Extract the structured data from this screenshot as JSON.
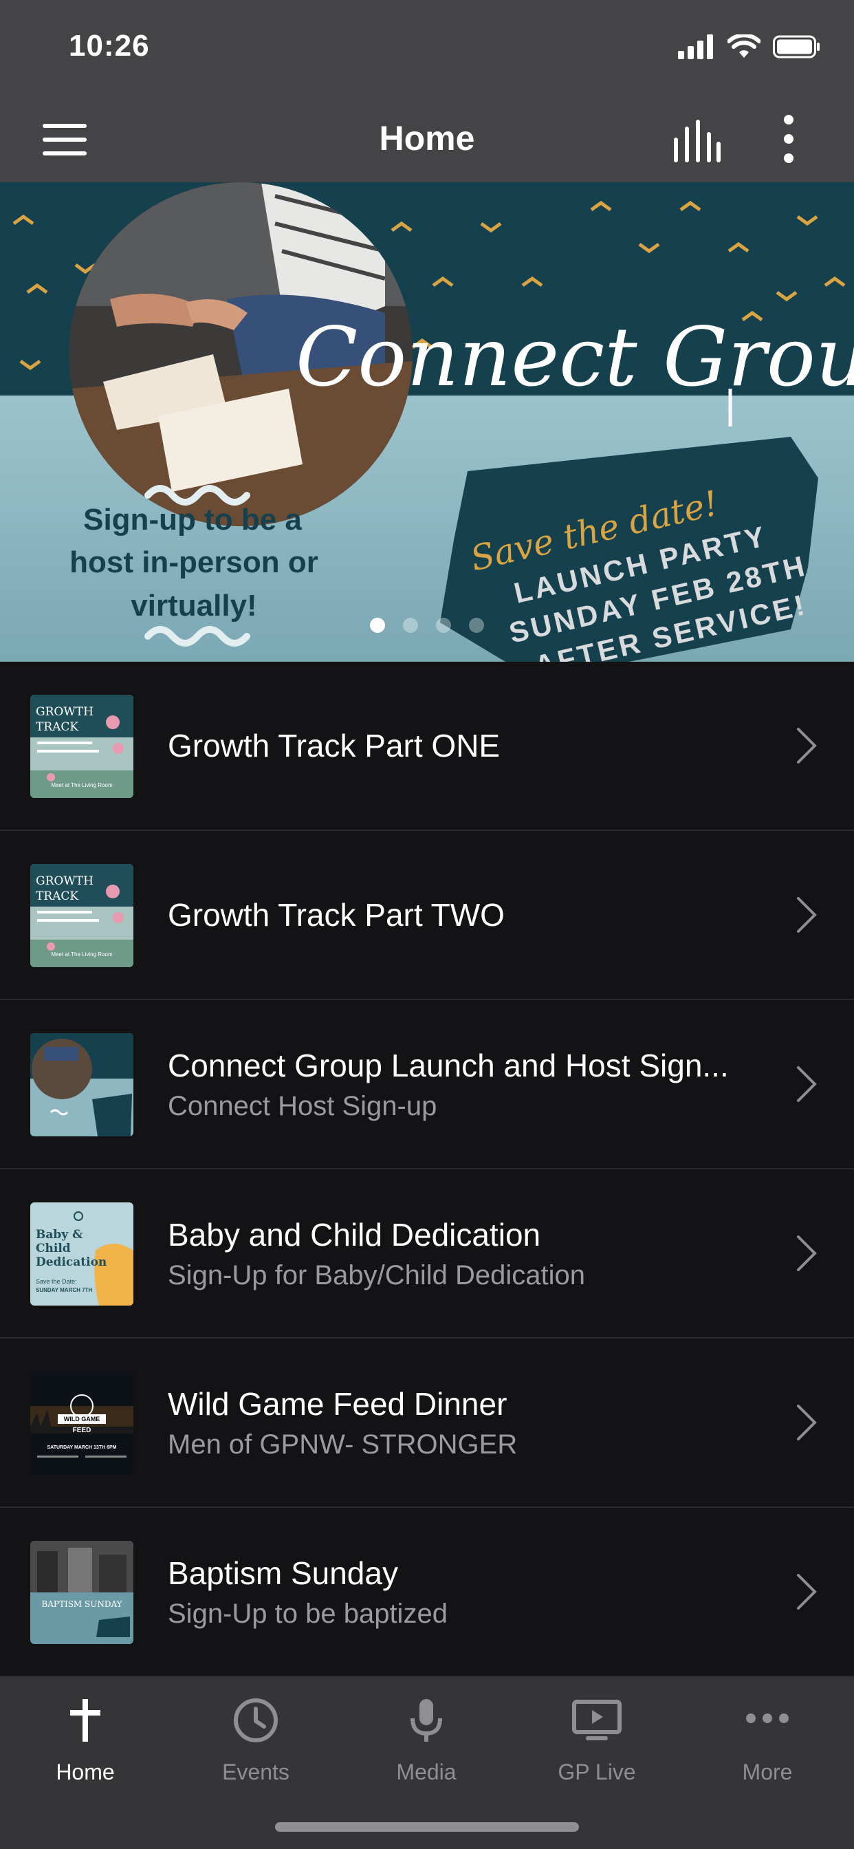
{
  "status_bar": {
    "time": "10:26"
  },
  "nav": {
    "title": "Home"
  },
  "banner": {
    "script_title": "Connect Groups",
    "signup_text": [
      "Sign-up to be a",
      "host in-person or",
      "virtually!"
    ],
    "save_the_date": "Save the date!",
    "launch_lines": [
      "LAUNCH PARTY",
      "SUNDAY FEB 28TH",
      "AFTER SERVICE!"
    ],
    "page_count": 4,
    "active_page": 1
  },
  "list": {
    "items": [
      {
        "title": "Growth Track Part ONE",
        "subtitle": "",
        "thumb": "growth-track"
      },
      {
        "title": "Growth Track Part TWO",
        "subtitle": "",
        "thumb": "growth-track"
      },
      {
        "title": "Connect Group Launch and Host Sign...",
        "subtitle": "Connect Host Sign-up",
        "thumb": "connect-groups"
      },
      {
        "title": "Baby and Child Dedication",
        "subtitle": "Sign-Up for Baby/Child Dedication",
        "thumb": "baby-dedication"
      },
      {
        "title": "Wild Game Feed Dinner",
        "subtitle": "Men of GPNW- STRONGER",
        "thumb": "wild-game"
      },
      {
        "title": "Baptism Sunday",
        "subtitle": "Sign-Up to be baptized",
        "thumb": "baptism"
      }
    ],
    "thumb_text": {
      "growth": [
        "GROWTH",
        "TRACK"
      ],
      "growth_small": "Meet at The Living Room",
      "baby": [
        "Baby &",
        "Child",
        "Dedication"
      ],
      "baby_date": [
        "Save the Date:",
        "SUNDAY MARCH 7TH"
      ],
      "wild": [
        "WILD GAME",
        "FEED"
      ],
      "wild_date": "SATURDAY MARCH 13TH 6PM",
      "baptism": "BAPTISM SUNDAY"
    }
  },
  "tabbar": {
    "tabs": [
      {
        "label": "Home",
        "icon": "cross-icon",
        "active": true
      },
      {
        "label": "Events",
        "icon": "clock-icon",
        "active": false
      },
      {
        "label": "Media",
        "icon": "microphone-icon",
        "active": false
      },
      {
        "label": "GP Live",
        "icon": "video-play-icon",
        "active": false
      },
      {
        "label": "More",
        "icon": "ellipsis-icon",
        "active": false
      }
    ]
  },
  "colors": {
    "bar_bg": "#444446",
    "list_bg": "#131315",
    "tab_bg": "#353537",
    "banner_teal": "#15404e",
    "banner_light": "#8fb7c1",
    "gold": "#d9a441"
  }
}
